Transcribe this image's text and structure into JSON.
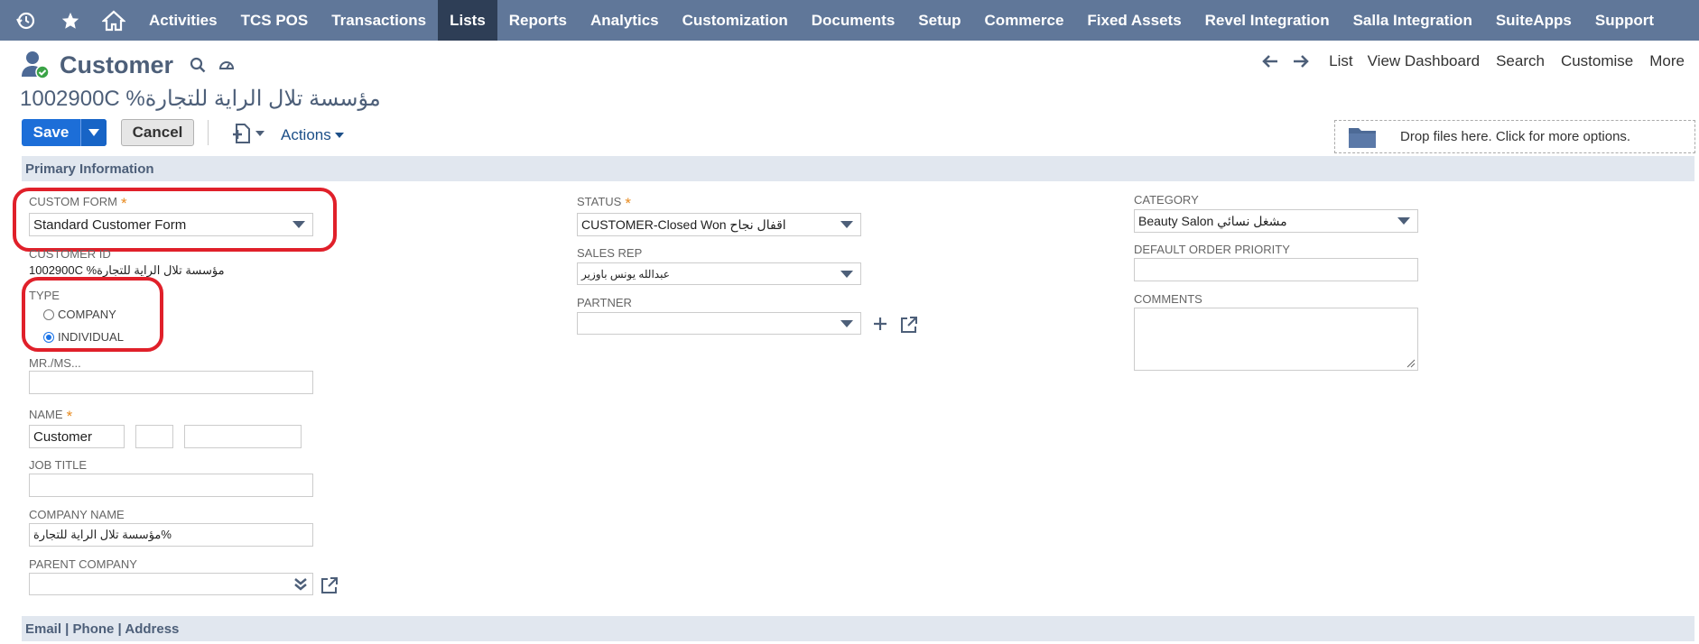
{
  "nav": {
    "items": [
      "Activities",
      "TCS POS",
      "Transactions",
      "Lists",
      "Reports",
      "Analytics",
      "Customization",
      "Documents",
      "Setup",
      "Commerce",
      "Fixed Assets",
      "Revel Integration",
      "Salla Integration",
      "SuiteApps",
      "Support"
    ],
    "active": "Lists"
  },
  "header": {
    "title": "Customer",
    "record_name": "1002900C %مؤسسة تلال الراية للتجارة",
    "links": [
      "List",
      "View Dashboard",
      "Search",
      "Customise",
      "More"
    ]
  },
  "toolbar": {
    "save_label": "Save",
    "cancel_label": "Cancel",
    "actions_label": "Actions",
    "dropzone_text": "Drop files here. Click for more options."
  },
  "sections": {
    "primary": "Primary Information",
    "contact": "Email | Phone | Address"
  },
  "fields": {
    "custom_form": {
      "label": "CUSTOM FORM",
      "value": "Standard Customer Form"
    },
    "customer_id": {
      "label": "CUSTOMER ID",
      "value": "1002900C %مؤسسة تلال الراية للتجارة"
    },
    "type": {
      "label": "TYPE",
      "options": [
        "COMPANY",
        "INDIVIDUAL"
      ],
      "selected": "INDIVIDUAL"
    },
    "mr_ms": {
      "label": "MR./MS...",
      "value": ""
    },
    "name": {
      "label": "NAME",
      "first": "Customer",
      "middle": "",
      "last": ""
    },
    "job_title": {
      "label": "JOB TITLE",
      "value": ""
    },
    "company_name": {
      "label": "COMPANY NAME",
      "value": "مؤسسة تلال الراية للتجارة%"
    },
    "parent_company": {
      "label": "PARENT COMPANY",
      "value": ""
    },
    "status": {
      "label": "STATUS",
      "value": "CUSTOMER-Closed Won اقفال نجاح"
    },
    "sales_rep": {
      "label": "SALES REP",
      "value": "عبدالله يونس باوزير"
    },
    "partner": {
      "label": "PARTNER",
      "value": ""
    },
    "category": {
      "label": "CATEGORY",
      "value": "Beauty Salon مشغل نسائي"
    },
    "default_order_priority": {
      "label": "DEFAULT ORDER PRIORITY",
      "value": ""
    },
    "comments": {
      "label": "COMMENTS",
      "value": ""
    }
  },
  "colors": {
    "nav_bg": "#607799",
    "nav_active": "#2e3e56",
    "accent": "#1c6ed8",
    "section_bg": "#e1e7ef",
    "required": "#e88b20",
    "highlight": "#e0202a"
  },
  "icons": [
    "recent-records-icon",
    "star-icon",
    "home-icon",
    "customer-icon",
    "search-icon",
    "dashboard-icon",
    "arrow-left-icon",
    "arrow-right-icon",
    "new-document-icon",
    "folder-icon",
    "plus-icon",
    "open-link-icon",
    "double-chevron-down-icon"
  ]
}
